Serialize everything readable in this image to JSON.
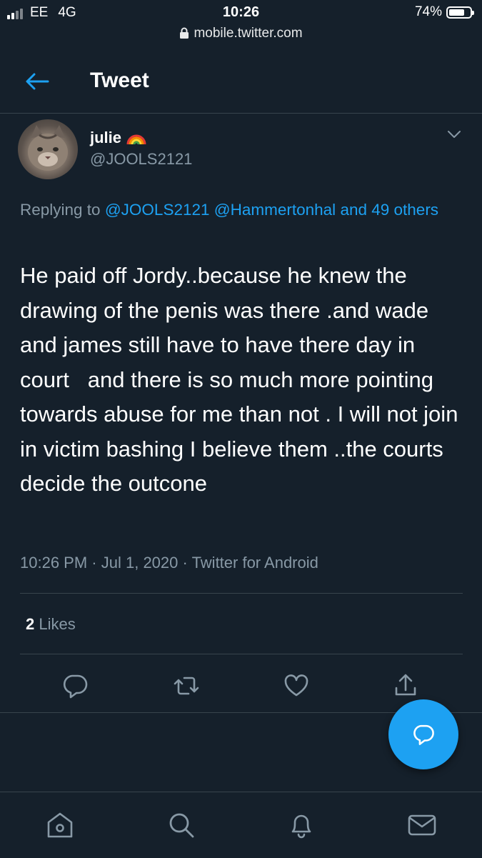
{
  "status_bar": {
    "carrier": "EE",
    "network": "4G",
    "time": "10:26",
    "battery": "74%",
    "battery_level": 0.74,
    "url": "mobile.twitter.com"
  },
  "header": {
    "title": "Tweet",
    "back_icon": "arrow-left-icon"
  },
  "tweet": {
    "author_name": "julie",
    "author_emoji": "🌈",
    "handle": "@JOOLS2121",
    "replying_prefix": "Replying to",
    "replying_mentions": [
      "@JOOLS2121",
      "@Hammertonhal"
    ],
    "replying_others": "and 49 others",
    "text": "He paid off Jordy..because he knew the drawing of the penis was there .and wade and james still have to have there day in court   and there is so much more pointing towards abuse for me than not . I will not join in victim bashing I believe them ..the courts decide the outcone",
    "time": "10:26 PM",
    "date": "Jul 1, 2020",
    "source": "Twitter for Android",
    "sep": "·",
    "likes_count": "2",
    "likes_label": "Likes"
  },
  "actions": [
    "reply-icon",
    "retweet-icon",
    "like-icon",
    "share-icon"
  ],
  "fab": {
    "icon": "compose-reply-icon"
  },
  "bottom_nav": [
    "home-icon",
    "search-icon",
    "notifications-icon",
    "messages-icon"
  ],
  "colors": {
    "background": "#15202b",
    "accent": "#1da1f2",
    "secondary_text": "#8899a6",
    "border": "#38444d"
  }
}
